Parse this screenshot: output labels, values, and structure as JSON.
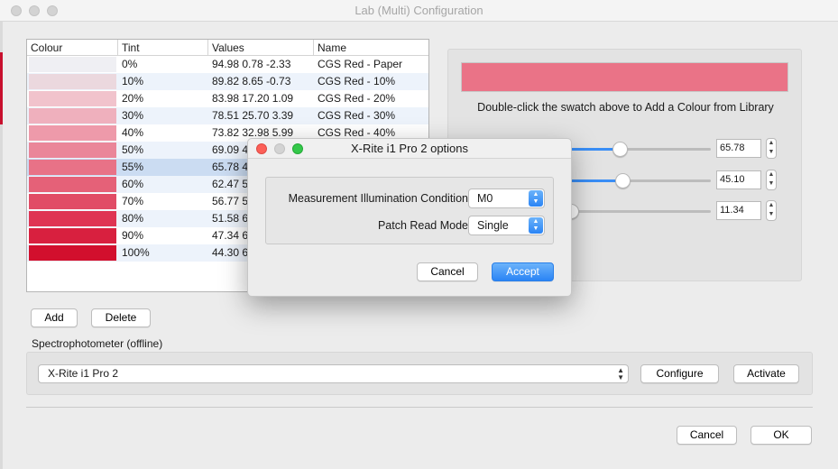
{
  "window": {
    "title": "Lab (Multi) Configuration"
  },
  "table": {
    "headers": [
      "Colour",
      "Tint",
      "Values",
      "Name"
    ],
    "rows": [
      {
        "color": "#efeff3",
        "tint": "0%",
        "values": "94.98 0.78 -2.33",
        "name": "CGS Red - Paper"
      },
      {
        "color": "#ebd8de",
        "tint": "10%",
        "values": "89.82 8.65 -0.73",
        "name": "CGS Red - 10%"
      },
      {
        "color": "#f1c3cc",
        "tint": "20%",
        "values": "83.98 17.20 1.09",
        "name": "CGS Red - 20%"
      },
      {
        "color": "#efb0bd",
        "tint": "30%",
        "values": "78.51 25.70 3.39",
        "name": "CGS Red - 30%"
      },
      {
        "color": "#ee9aaa",
        "tint": "40%",
        "values": "73.82 32.98 5.99",
        "name": "CGS Red - 40%"
      },
      {
        "color": "#ea8699",
        "tint": "50%",
        "values": "69.09 4",
        "name": ""
      },
      {
        "color": "#e87287",
        "tint": "55%",
        "values": "65.78 4",
        "name": ""
      },
      {
        "color": "#e56178",
        "tint": "60%",
        "values": "62.47 5",
        "name": ""
      },
      {
        "color": "#e14c66",
        "tint": "70%",
        "values": "56.77 5",
        "name": ""
      },
      {
        "color": "#df3453",
        "tint": "80%",
        "values": "51.58 6",
        "name": ""
      },
      {
        "color": "#d8203f",
        "tint": "90%",
        "values": "47.34 6",
        "name": ""
      },
      {
        "color": "#d20f2d",
        "tint": "100%",
        "values": "44.30 6",
        "name": ""
      }
    ]
  },
  "buttons": {
    "add": "Add",
    "delete": "Delete",
    "configure": "Configure",
    "activate": "Activate",
    "cancel": "Cancel",
    "ok": "OK"
  },
  "right_panel": {
    "swatch_color": "#ea7387",
    "hint": "Double-click the swatch above to Add a Colour from Library",
    "fields": [
      {
        "value": "65.78",
        "level": 0.35
      },
      {
        "value": "45.10",
        "level": 0.37
      },
      {
        "value": "11.34",
        "level": 0.0
      }
    ]
  },
  "spectro": {
    "section_label": "Spectrophotometer (offline)",
    "device": "X-Rite i1 Pro 2"
  },
  "modal": {
    "title": "X-Rite i1 Pro 2 options",
    "illumination_label": "Measurement Illumination Condition",
    "illumination_value": "M0",
    "patch_label": "Patch Read Mode",
    "patch_value": "Single",
    "cancel": "Cancel",
    "accept": "Accept"
  }
}
